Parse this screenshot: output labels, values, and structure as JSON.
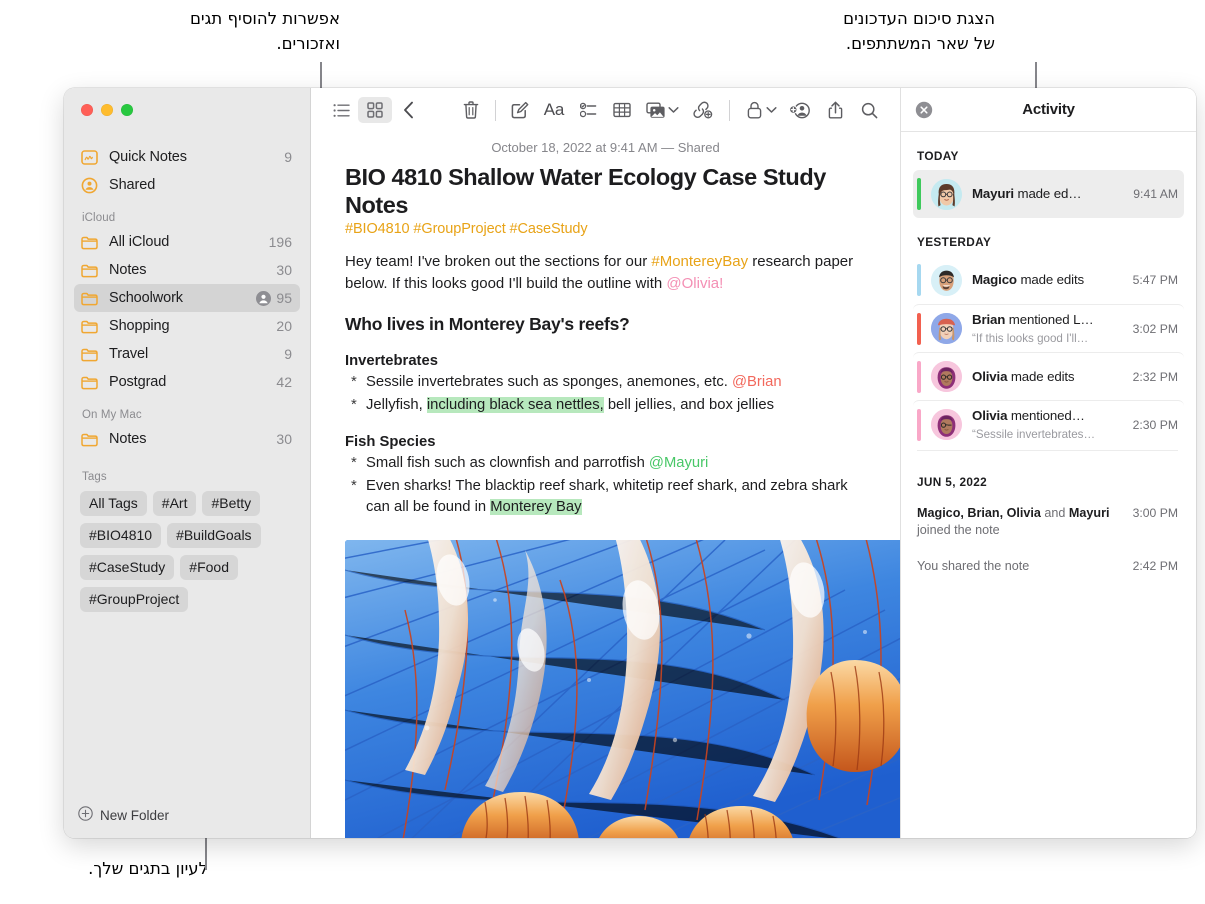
{
  "callouts": {
    "tags": "אפשרות להוסיף תגים\nואזכורים.",
    "activity": "הצגת סיכום העדכונים\nשל שאר המשתתפים.",
    "browse": "לעיון בתגים שלך."
  },
  "window": {
    "traffic_lights": [
      "close",
      "minimize",
      "zoom"
    ]
  },
  "sidebar": {
    "top_items": [
      {
        "icon": "quick-notes-icon",
        "label": "Quick Notes",
        "count": "9"
      },
      {
        "icon": "shared-person-icon",
        "label": "Shared",
        "count": ""
      }
    ],
    "sections": [
      {
        "header": "iCloud",
        "items": [
          {
            "icon": "folder-icon",
            "label": "All iCloud",
            "count": "196",
            "shared": false,
            "selected": false
          },
          {
            "icon": "folder-icon",
            "label": "Notes",
            "count": "30",
            "shared": false,
            "selected": false
          },
          {
            "icon": "folder-icon",
            "label": "Schoolwork",
            "count": "95",
            "shared": true,
            "selected": true
          },
          {
            "icon": "folder-icon",
            "label": "Shopping",
            "count": "20",
            "shared": false,
            "selected": false
          },
          {
            "icon": "folder-icon",
            "label": "Travel",
            "count": "9",
            "shared": false,
            "selected": false
          },
          {
            "icon": "folder-icon",
            "label": "Postgrad",
            "count": "42",
            "shared": false,
            "selected": false
          }
        ]
      },
      {
        "header": "On My Mac",
        "items": [
          {
            "icon": "folder-icon",
            "label": "Notes",
            "count": "30",
            "shared": false,
            "selected": false
          }
        ]
      }
    ],
    "tags_header": "Tags",
    "tags": [
      "All Tags",
      "#Art",
      "#Betty",
      "#BIO4810",
      "#BuildGoals",
      "#CaseStudy",
      "#Food",
      "#GroupProject"
    ],
    "new_folder_label": "New Folder"
  },
  "toolbar": {
    "list_view_label": "list-view",
    "gallery_view_label": "gallery-view",
    "back_label": "back",
    "delete_label": "delete",
    "compose_label": "compose",
    "format_label": "Aa",
    "checklist_label": "checklist",
    "table_label": "table",
    "media_label": "media",
    "link_label": "link",
    "lock_label": "lock",
    "add_people_label": "add-people",
    "share_label": "share",
    "search_label": "search"
  },
  "note": {
    "date": "October 18, 2022 at 9:41 AM — Shared",
    "title": "BIO 4810 Shallow Water Ecology Case Study Notes",
    "tags_line": "#BIO4810 #GroupProject #CaseStudy",
    "paragraph": {
      "part1": "Hey team! I've broken out the sections for our ",
      "tag": "#MontereyBay",
      "part2": " research paper below. If this looks good I'll build the outline with ",
      "mention": "@Olivia!"
    },
    "heading": "Who lives in Monterey Bay's reefs?",
    "sections": [
      {
        "subheading": "Invertebrates",
        "bullets": [
          {
            "text": "Sessile invertebrates such as sponges, anemones, etc. ",
            "mention": "@Brian",
            "mention_color": "red",
            "highlight": "",
            "tail": ""
          },
          {
            "text": "Jellyfish, ",
            "mention": "",
            "mention_color": "",
            "highlight": "including black sea nettles,",
            "tail": " bell jellies, and box jellies"
          }
        ]
      },
      {
        "subheading": "Fish Species",
        "bullets": [
          {
            "text": "Small fish such as clownfish and parrotfish ",
            "mention": "@Mayuri",
            "mention_color": "green",
            "highlight": "",
            "tail": ""
          },
          {
            "text": "Even sharks! The blacktip reef shark, whitetip reef shark, and zebra shark can all be found in ",
            "mention": "",
            "mention_color": "",
            "highlight": "Monterey Bay",
            "tail": ""
          }
        ]
      }
    ],
    "image_alt": "jellyfish-photo"
  },
  "activity": {
    "title": "Activity",
    "groups": [
      {
        "label": "TODAY",
        "rows": [
          {
            "name": "Mayuri",
            "action": " made ed…",
            "quote": "",
            "time": "9:41 AM",
            "bar_color": "#3fc95c",
            "avatar_bg": "#c5eaf0",
            "selected": true
          }
        ]
      },
      {
        "label": "YESTERDAY",
        "rows": [
          {
            "name": "Magico",
            "action": " made edits",
            "quote": "",
            "time": "5:47 PM",
            "bar_color": "#a6d8f0",
            "avatar_bg": "#d8f0f7",
            "selected": false
          },
          {
            "name": "Brian",
            "action": " mentioned L…",
            "quote": "“If this looks good I'll…",
            "time": "3:02 PM",
            "bar_color": "#f2604f",
            "avatar_bg": "#8fa8e8",
            "selected": false
          },
          {
            "name": "Olivia",
            "action": " made edits",
            "quote": "",
            "time": "2:32 PM",
            "bar_color": "#f9a8c8",
            "avatar_bg": "#f7c6dd",
            "selected": false
          },
          {
            "name": "Olivia",
            "action": " mentioned…",
            "quote": "“Sessile invertebrates…",
            "time": "2:30 PM",
            "bar_color": "#f9a8c8",
            "avatar_bg": "#f7c6dd",
            "selected": false
          }
        ]
      }
    ],
    "older": {
      "label": "JUN 5, 2022",
      "entries": [
        {
          "names": "Magico, Brian, Olivia",
          "conj": " and ",
          "names2": "Mayuri",
          "rest": " joined the note",
          "time": "3:00 PM"
        },
        {
          "names": "",
          "conj": "",
          "names2": "",
          "rest": "You shared the note",
          "time": "2:42 PM"
        }
      ]
    }
  },
  "colors": {
    "accent_orange": "#f0a732",
    "tag_amber": "#e8a317",
    "highlight_green": "#b7e8bd",
    "selected_gray": "#d4d4d4"
  }
}
